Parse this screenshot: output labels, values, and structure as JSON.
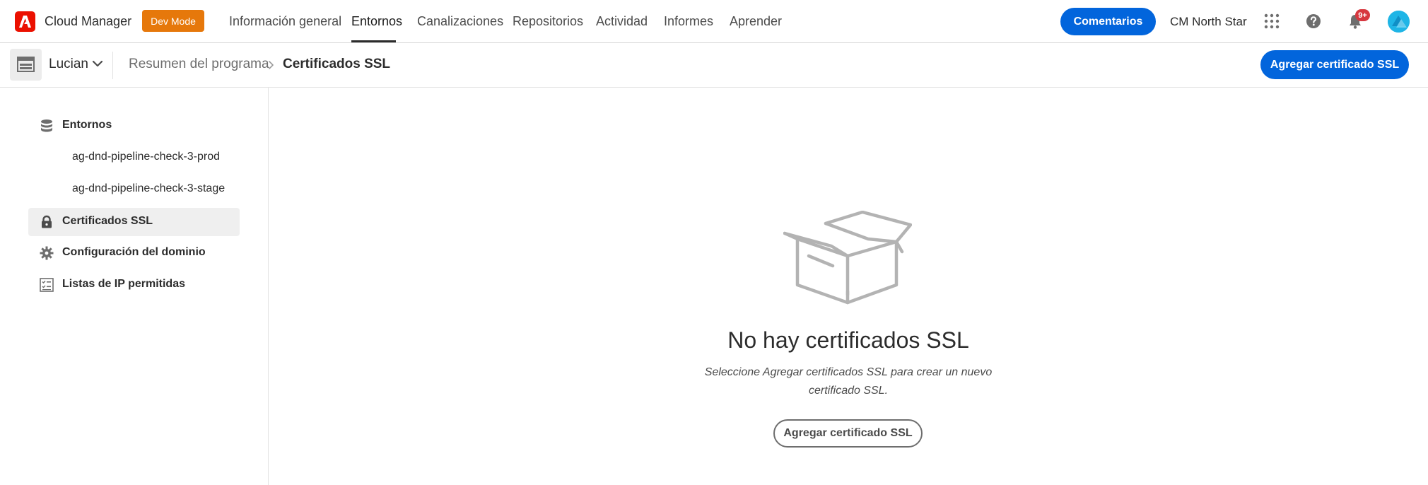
{
  "header": {
    "app_title": "Cloud Manager",
    "dev_mode_badge": "Dev Mode",
    "nav": [
      {
        "label": "Información general",
        "active": false
      },
      {
        "label": "Entornos",
        "active": true
      },
      {
        "label": "Canalizaciones",
        "active": false
      },
      {
        "label": "Repositorios",
        "active": false
      },
      {
        "label": "Actividad",
        "active": false
      },
      {
        "label": "Informes",
        "active": false
      },
      {
        "label": "Aprender",
        "active": false
      }
    ],
    "feedback_label": "Comentarios",
    "org_name": "CM North Star",
    "notification_badge": "9+",
    "icons": [
      "adobe-logo-icon",
      "app-switcher-icon",
      "help-icon",
      "bell-icon",
      "avatar"
    ]
  },
  "subheader": {
    "program_name": "Lucian",
    "breadcrumb": [
      "Resumen del programa",
      "Certificados SSL"
    ],
    "add_button_label": "Agregar certificado SSL"
  },
  "sidebar": {
    "items": [
      {
        "label": "Entornos",
        "icon": "database-icon",
        "selected": false
      },
      {
        "label": "ag-dnd-pipeline-check-3-prod",
        "sub": true
      },
      {
        "label": "ag-dnd-pipeline-check-3-stage",
        "sub": true
      },
      {
        "label": "Certificados SSL",
        "icon": "lock-icon",
        "selected": true
      },
      {
        "label": "Configuración del dominio",
        "icon": "gear-icon",
        "selected": false
      },
      {
        "label": "Listas de IP permitidas",
        "icon": "checklist-icon",
        "selected": false
      }
    ]
  },
  "main": {
    "empty_title": "No hay certificados SSL",
    "empty_description": "Seleccione Agregar certificados SSL para crear un nuevo certificado SSL.",
    "add_button_label": "Agregar certificado SSL"
  },
  "colors": {
    "accent_blue": "#0265dc",
    "adobe_red": "#eb1000",
    "dev_mode_orange": "#e6780b",
    "badge_red": "#d7373f"
  }
}
